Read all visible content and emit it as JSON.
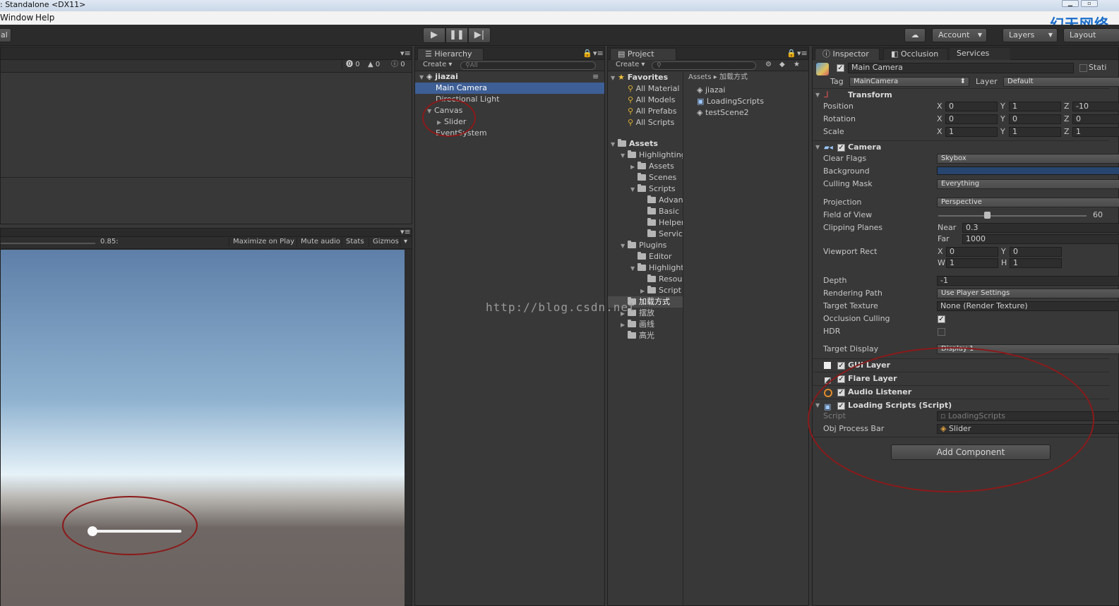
{
  "window": {
    "title": ": Standalone <DX11>",
    "logo": "幻天网络"
  },
  "menu": {
    "window": "Window",
    "help": "Help"
  },
  "toolbar": {
    "left_stub": "al",
    "play": "▶",
    "pause": "❚❚",
    "step": "▶|",
    "cloud": "☁",
    "account": "Account",
    "layers": "Layers",
    "layout": "Layout"
  },
  "console": {
    "err": "0",
    "warn": "0",
    "info": "0"
  },
  "game": {
    "scale": "0.85:",
    "maximize": "Maximize on Play",
    "mute": "Mute audio",
    "stats": "Stats",
    "gizmos": "Gizmos"
  },
  "hierarchy": {
    "tab": "Hierarchy",
    "create": "Create",
    "search": "All",
    "scene": "jiazai",
    "items": [
      "Main Camera",
      "Directional Light",
      "Canvas",
      "Slider",
      "EventSystem"
    ]
  },
  "project": {
    "tab": "Project",
    "create": "Create",
    "favorites": "Favorites",
    "fav_items": [
      "All Material",
      "All Models",
      "All Prefabs",
      "All Scripts"
    ],
    "assets": "Assets",
    "tree": [
      "Highlighting",
      "Assets",
      "Scenes",
      "Scripts",
      "Advan",
      "Basic",
      "Helper",
      "Servic",
      "Plugins",
      "Editor",
      "Highlight",
      "Resou",
      "Script",
      "加载方式",
      "摆放",
      "画线",
      "高光"
    ],
    "breadcrumb_root": "Assets",
    "breadcrumb_sep": "▸",
    "breadcrumb_leaf": "加载方式",
    "files": [
      "jiazai",
      "LoadingScripts",
      "testScene2"
    ]
  },
  "watermark": "http://blog.csdn.net",
  "inspector": {
    "tab": "Inspector",
    "tab2": "Occlusion",
    "tab3": "Services",
    "object": "Main Camera",
    "static": "Stati",
    "tag_label": "Tag",
    "tag": "MainCamera",
    "layer_label": "Layer",
    "layer": "Default",
    "transform": {
      "title": "Transform",
      "position_label": "Position",
      "rotation_label": "Rotation",
      "scale_label": "Scale",
      "x": "X",
      "y": "Y",
      "z": "Z",
      "position": [
        "0",
        "1",
        "-10"
      ],
      "rotation": [
        "0",
        "0",
        "0"
      ],
      "scale": [
        "1",
        "1",
        "1"
      ]
    },
    "camera": {
      "title": "Camera",
      "clear_flags_label": "Clear Flags",
      "clear_flags": "Skybox",
      "background_label": "Background",
      "culling_label": "Culling Mask",
      "culling": "Everything",
      "projection_label": "Projection",
      "projection": "Perspective",
      "fov_label": "Field of View",
      "fov": "60",
      "clip_label": "Clipping Planes",
      "near_label": "Near",
      "near": "0.3",
      "far_label": "Far",
      "far": "1000",
      "viewport_label": "Viewport Rect",
      "vx": "0",
      "vy": "0",
      "vw": "1",
      "vh": "1",
      "w": "W",
      "h": "H",
      "depth_label": "Depth",
      "depth": "-1",
      "render_label": "Rendering Path",
      "render": "Use Player Settings",
      "target_tex_label": "Target Texture",
      "target_tex": "None (Render Texture)",
      "occlusion_label": "Occlusion Culling",
      "hdr_label": "HDR",
      "display_label": "Target Display",
      "display": "Display 1"
    },
    "components": [
      "GUI Layer",
      "Flare Layer",
      "Audio Listener",
      "Loading Scripts (Script)"
    ],
    "script_label": "Script",
    "script": "LoadingScripts",
    "obj_label": "Obj Process Bar",
    "obj": "Slider",
    "add_component": "Add Component"
  },
  "colors": {
    "accent": "#3e5f96",
    "background_swatch": "#27456f",
    "annotation": "#8a1a1a"
  }
}
